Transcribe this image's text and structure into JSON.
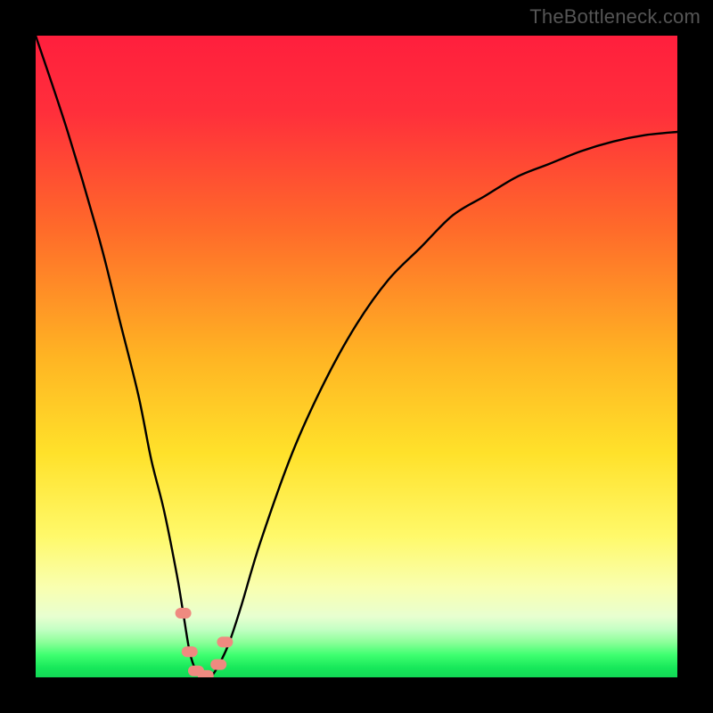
{
  "watermark": "TheBottleneck.com",
  "chart_data": {
    "type": "line",
    "title": "",
    "xlabel": "",
    "ylabel": "",
    "xlim": [
      0,
      100
    ],
    "ylim": [
      0,
      100
    ],
    "gradient_stops": [
      {
        "pos": 0.0,
        "color": "#ff1f3d"
      },
      {
        "pos": 0.12,
        "color": "#ff2f3b"
      },
      {
        "pos": 0.3,
        "color": "#ff6a2a"
      },
      {
        "pos": 0.5,
        "color": "#ffb423"
      },
      {
        "pos": 0.65,
        "color": "#ffe12a"
      },
      {
        "pos": 0.78,
        "color": "#fff96a"
      },
      {
        "pos": 0.86,
        "color": "#f9ffb0"
      },
      {
        "pos": 0.905,
        "color": "#e8ffd0"
      },
      {
        "pos": 0.925,
        "color": "#c4ffc4"
      },
      {
        "pos": 0.945,
        "color": "#8dff9a"
      },
      {
        "pos": 0.965,
        "color": "#3fff70"
      },
      {
        "pos": 0.985,
        "color": "#17e85a"
      },
      {
        "pos": 1.0,
        "color": "#12d856"
      }
    ],
    "series": [
      {
        "name": "bottleneck-curve",
        "x": [
          0,
          5,
          10,
          13,
          16,
          18,
          20,
          22,
          23,
          24,
          25,
          26,
          27,
          28,
          30,
          32,
          35,
          40,
          45,
          50,
          55,
          60,
          65,
          70,
          75,
          80,
          85,
          90,
          95,
          100
        ],
        "y": [
          100,
          85,
          68,
          56,
          44,
          34,
          26,
          16,
          10,
          4,
          1,
          0,
          0,
          1,
          5,
          11,
          21,
          35,
          46,
          55,
          62,
          67,
          72,
          75,
          78,
          80,
          82,
          83.5,
          84.5,
          85
        ]
      }
    ],
    "markers": [
      {
        "x": 23.0,
        "y": 10.0,
        "color": "#ef8a80"
      },
      {
        "x": 24.0,
        "y": 4.0,
        "color": "#ef8a80"
      },
      {
        "x": 25.0,
        "y": 1.0,
        "color": "#ef8a80"
      },
      {
        "x": 26.5,
        "y": 0.3,
        "color": "#ef8a80"
      },
      {
        "x": 28.5,
        "y": 2.0,
        "color": "#ef8a80"
      },
      {
        "x": 29.5,
        "y": 5.5,
        "color": "#ef8a80"
      }
    ]
  }
}
